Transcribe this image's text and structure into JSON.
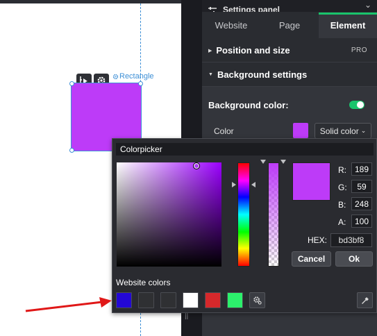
{
  "canvas": {
    "element_label": "Rectangle",
    "element_color": "#bd3bf8"
  },
  "panel": {
    "title": "Settings panel",
    "tabs": [
      {
        "label": "Website",
        "active": false
      },
      {
        "label": "Page",
        "active": false
      },
      {
        "label": "Element",
        "active": true
      }
    ],
    "sections": {
      "position_size": {
        "label": "Position and size",
        "badge": "PRO"
      },
      "background": {
        "label": "Background settings"
      }
    },
    "background_color_label": "Background color:",
    "background_color_enabled": true,
    "color_label": "Color",
    "fill_type": "Solid color",
    "accent_color": "#19c46c"
  },
  "colorpicker": {
    "title": "Colorpicker",
    "channels": [
      {
        "label": "R:",
        "value": "189"
      },
      {
        "label": "G:",
        "value": "59"
      },
      {
        "label": "B:",
        "value": "248"
      },
      {
        "label": "A:",
        "value": "100"
      }
    ],
    "hex_label": "HEX:",
    "hex_value": "bd3bf8",
    "cancel_label": "Cancel",
    "ok_label": "Ok",
    "website_colors_label": "Website colors",
    "website_colors": [
      "#2308d6",
      "#2f3033",
      "#2f3033",
      "#ffffff",
      "#d6282b",
      "#2cf06c"
    ]
  },
  "annotation": {
    "arrow_color": "#e01818"
  }
}
